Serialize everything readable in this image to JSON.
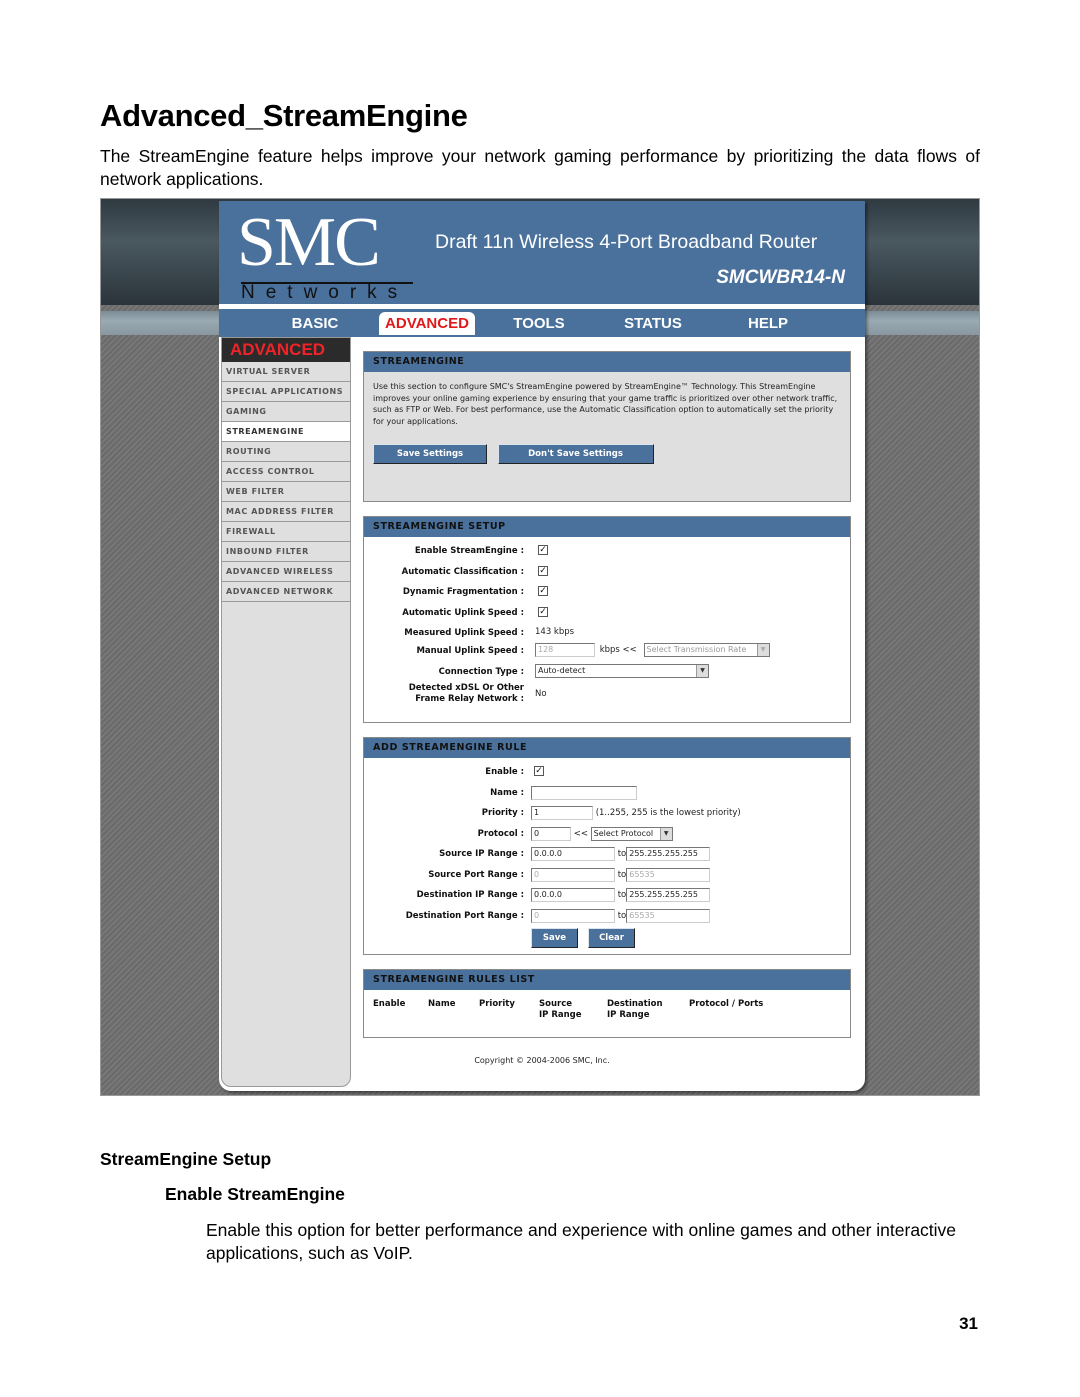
{
  "document": {
    "title": "Advanced_StreamEngine",
    "intro": "The StreamEngine feature helps improve your network gaming performance by prioritizing the data flows of network applications.",
    "section_heading": "StreamEngine Setup",
    "subsection_heading": "Enable StreamEngine",
    "subsection_text": "Enable this option for better performance and experience with online games and other interactive applications, such as VoIP.",
    "page_number": "31"
  },
  "router_ui": {
    "logo": {
      "brand": "SMC",
      "sub": "Networks"
    },
    "product_name": "Draft 11n Wireless 4-Port Broadband Router",
    "model": "SMCWBR14-N",
    "colors": {
      "header_blue": "#4a719b",
      "active_red": "#e0191c",
      "sidebar_gray": "#dfdfdf"
    },
    "nav_tabs": [
      {
        "label": "BASIC",
        "active": false
      },
      {
        "label": "ADVANCED",
        "active": true
      },
      {
        "label": "TOOLS",
        "active": false
      },
      {
        "label": "STATUS",
        "active": false
      },
      {
        "label": "HELP",
        "active": false
      }
    ],
    "sidebar": {
      "heading": "ADVANCED",
      "items": [
        {
          "label": "VIRTUAL SERVER",
          "active": false
        },
        {
          "label": "SPECIAL APPLICATIONS",
          "active": false
        },
        {
          "label": "GAMING",
          "active": false
        },
        {
          "label": "STREAMENGINE",
          "active": true
        },
        {
          "label": "ROUTING",
          "active": false
        },
        {
          "label": "ACCESS CONTROL",
          "active": false
        },
        {
          "label": "WEB FILTER",
          "active": false
        },
        {
          "label": "MAC ADDRESS FILTER",
          "active": false
        },
        {
          "label": "FIREWALL",
          "active": false
        },
        {
          "label": "INBOUND FILTER",
          "active": false
        },
        {
          "label": "ADVANCED WIRELESS",
          "active": false
        },
        {
          "label": "ADVANCED NETWORK",
          "active": false
        }
      ]
    },
    "streamengine": {
      "heading": "STREAMENGINE",
      "description": "Use this section to configure SMC's StreamEngine powered by StreamEngine™ Technology. This StreamEngine improves your online gaming experience by ensuring that your game traffic is prioritized over other network traffic, such as FTP or Web. For best performance, use the Automatic Classification option to automatically set the priority for your applications.",
      "save_label": "Save Settings",
      "dont_save_label": "Don't Save Settings"
    },
    "setup": {
      "heading": "STREAMENGINE SETUP",
      "enable_label": "Enable StreamEngine :",
      "enable_checked": "✓",
      "auto_class_label": "Automatic Classification :",
      "auto_class_checked": "✓",
      "dyn_frag_label": "Dynamic Fragmentation :",
      "dyn_frag_checked": "✓",
      "auto_uplink_label": "Automatic Uplink Speed :",
      "auto_uplink_checked": "✓",
      "measured_label": "Measured Uplink Speed :",
      "measured_value": "143  kbps",
      "manual_label": "Manual Uplink Speed :",
      "manual_value": "128",
      "manual_unit": "kbps  <<",
      "rate_select": "Select Transmission Rate",
      "conn_type_label": "Connection Type :",
      "conn_type_value": "Auto-detect",
      "xdsl_label_1": "Detected xDSL Or Other",
      "xdsl_label_2": "Frame Relay Network :",
      "xdsl_value": "No"
    },
    "add_rule": {
      "heading": "ADD STREAMENGINE RULE",
      "enable_label": "Enable :",
      "enable_checked": "✓",
      "name_label": "Name :",
      "name_value": "",
      "priority_label": "Priority :",
      "priority_value": "1",
      "priority_hint": "(1..255, 255 is the lowest priority)",
      "protocol_label": "Protocol :",
      "protocol_value": "0",
      "protocol_sep": "<<",
      "protocol_select": "Select Protocol",
      "src_ip_label": "Source IP Range :",
      "src_ip_from": "0.0.0.0",
      "src_ip_to": "255.255.255.255",
      "src_port_label": "Source Port Range :",
      "src_port_from": "0",
      "src_port_to": "65535",
      "dst_ip_label": "Destination IP Range :",
      "dst_ip_from": "0.0.0.0",
      "dst_ip_to": "255.255.255.255",
      "dst_port_label": "Destination Port Range :",
      "dst_port_from": "0",
      "dst_port_to": "65535",
      "to_label": "to",
      "save_label": "Save",
      "clear_label": "Clear"
    },
    "rules_list": {
      "heading": "STREAMENGINE RULES LIST",
      "columns": [
        {
          "line1": "Enable",
          "line2": ""
        },
        {
          "line1": "Name",
          "line2": ""
        },
        {
          "line1": "Priority",
          "line2": ""
        },
        {
          "line1": "Source",
          "line2": "IP Range"
        },
        {
          "line1": "Destination",
          "line2": "IP Range"
        },
        {
          "line1": "Protocol / Ports",
          "line2": ""
        }
      ]
    },
    "copyright": "Copyright © 2004-2006 SMC, Inc."
  }
}
